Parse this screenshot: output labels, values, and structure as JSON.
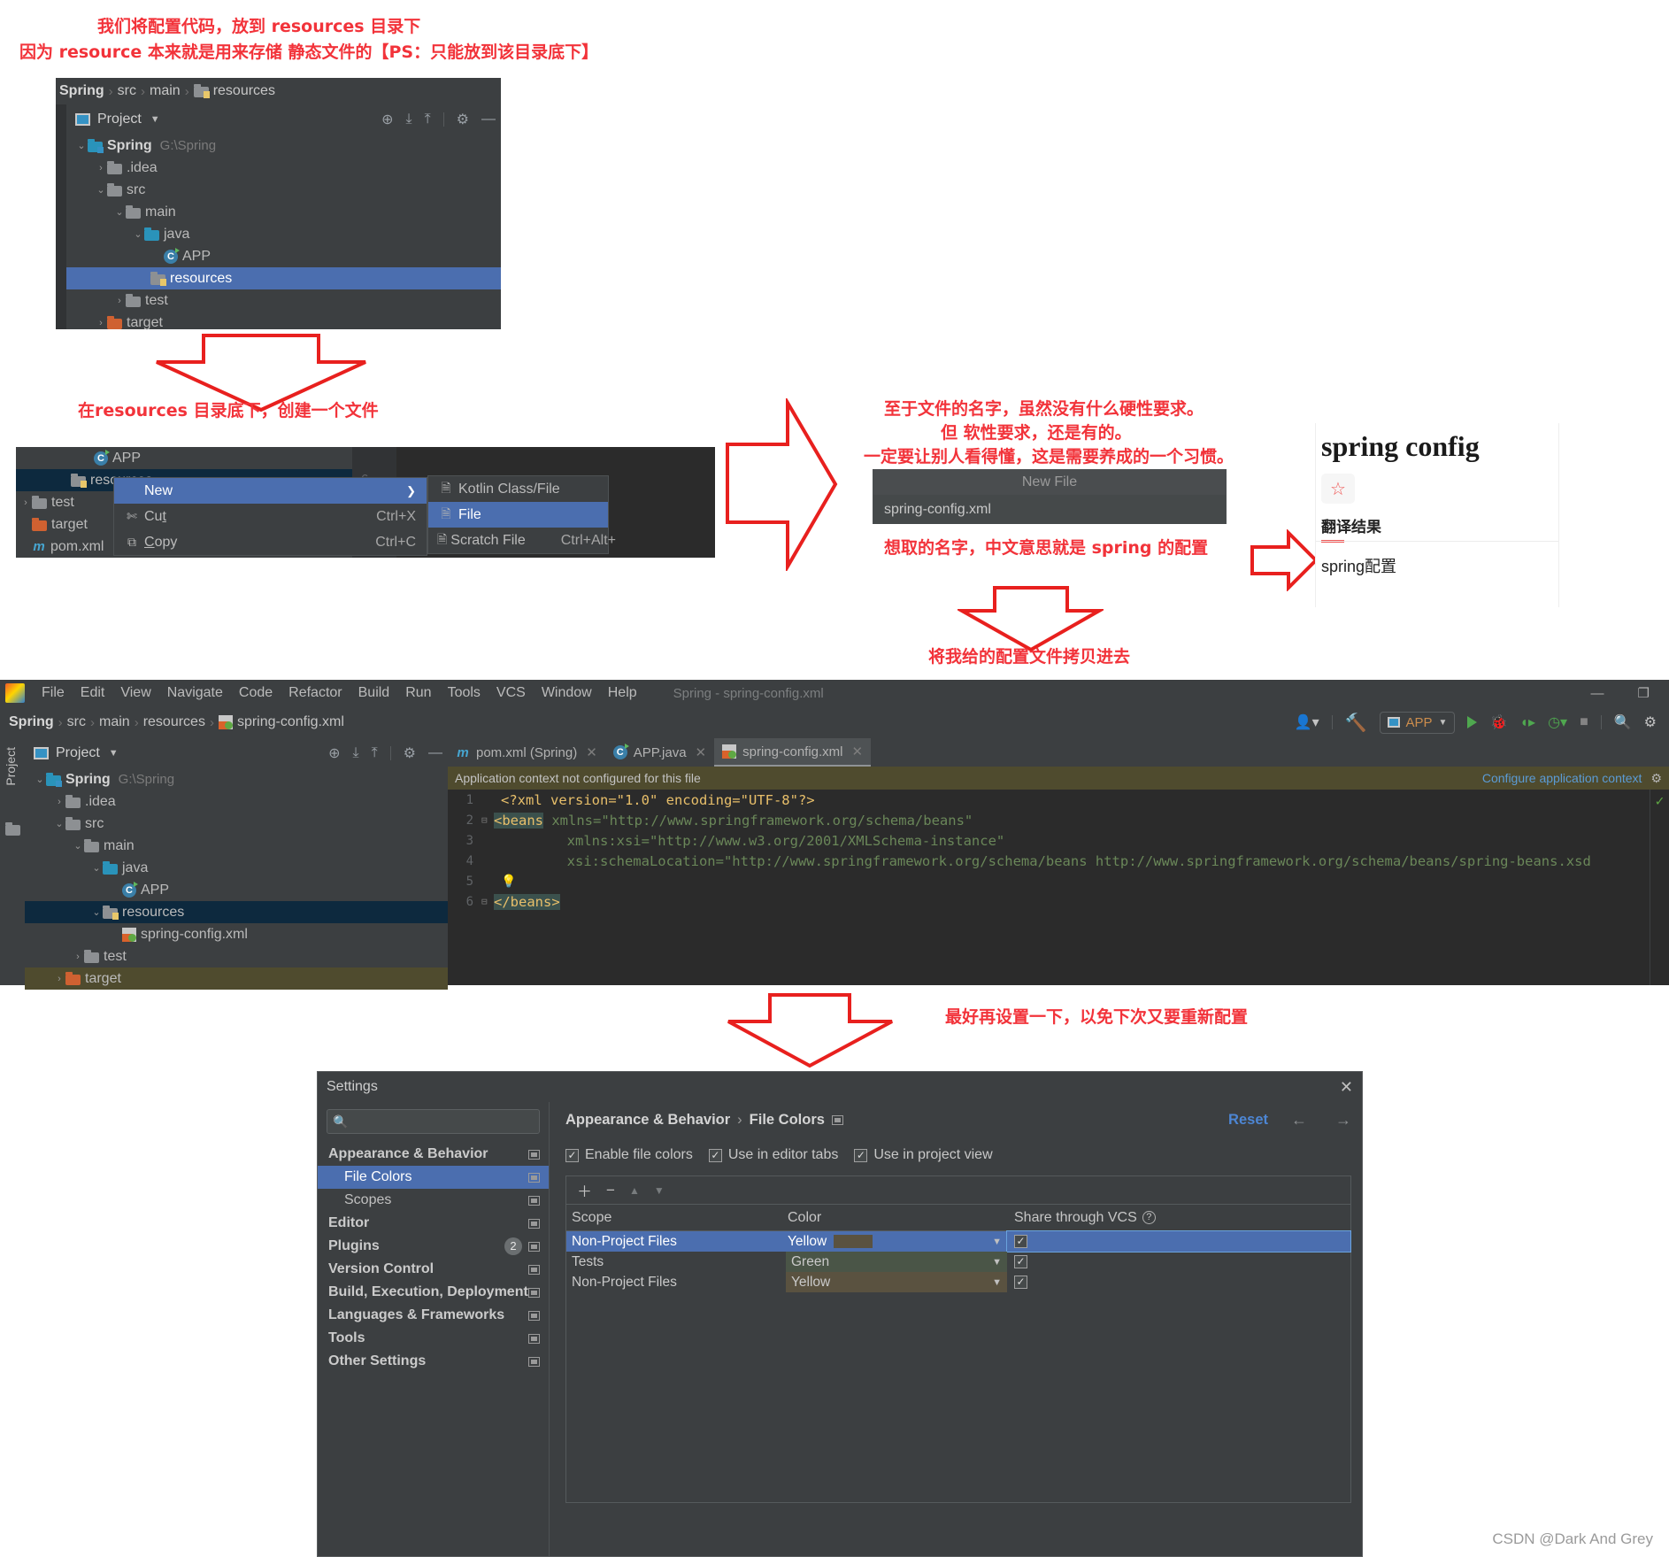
{
  "annotations": {
    "top_line1": "我们将配置代码，放到 resources 目录下",
    "top_line2": "因为 resource 本来就是用来存储 静态文件的【PS：只能放到该目录底下】",
    "create_file": "在resources 目录底下，创建一个文件",
    "name_line1": "至于文件的名字，虽然没有什么硬性要求。",
    "name_line2": "但 软性要求，还是有的。",
    "name_line3": "一定要让别人看得懂，这是需要养成的一个习惯。",
    "name_meaning": "想取的名字，中文意思就是 spring 的配置",
    "copy_config": "将我给的配置文件拷贝进去",
    "settings_hint": "最好再设置一下，以免下次又要重新配置"
  },
  "breadcrumb_top": {
    "items": [
      "Spring",
      "src",
      "main",
      "resources"
    ]
  },
  "project_panel_1": {
    "title": "Project",
    "tree": [
      {
        "label": "Spring",
        "path": "G:\\Spring",
        "icon": "module-folder-icon",
        "arrow": "v",
        "indent": 0,
        "bold": true
      },
      {
        "label": ".idea",
        "path": "",
        "icon": "folder-icon",
        "arrow": ">",
        "indent": 1,
        "bold": false
      },
      {
        "label": "src",
        "path": "",
        "icon": "folder-icon",
        "arrow": "v",
        "indent": 1,
        "bold": false
      },
      {
        "label": "main",
        "path": "",
        "icon": "folder-icon",
        "arrow": "v",
        "indent": 2,
        "bold": false
      },
      {
        "label": "java",
        "path": "",
        "icon": "source-folder-icon",
        "arrow": "v",
        "indent": 3,
        "bold": false
      },
      {
        "label": "APP",
        "path": "",
        "icon": "java-class-icon",
        "arrow": "",
        "indent": 4,
        "bold": false
      },
      {
        "label": "resources",
        "path": "",
        "icon": "resources-folder-icon",
        "arrow": "",
        "indent": 3,
        "bold": false,
        "selected": true
      },
      {
        "label": "test",
        "path": "",
        "icon": "folder-icon",
        "arrow": ">",
        "indent": 2,
        "bold": false
      },
      {
        "label": "target",
        "path": "",
        "icon": "target-folder-icon",
        "arrow": ">",
        "indent": 1,
        "bold": false
      }
    ]
  },
  "context_menu": {
    "tree_rows": [
      {
        "label": "APP",
        "icon": "java-class-icon",
        "indent": 3
      },
      {
        "label": "resources",
        "icon": "resources-folder-icon",
        "indent": 2,
        "selected": true
      },
      {
        "label": "test",
        "icon": "folder-icon",
        "arrow": ">",
        "indent": 1
      },
      {
        "label": "target",
        "icon": "target-folder-icon",
        "indent": 1
      },
      {
        "label": "pom.xml",
        "icon": "maven-icon",
        "indent": 0
      }
    ],
    "items": [
      {
        "label": "New",
        "icon": "",
        "accel": "",
        "submenu": true,
        "selected": true
      },
      {
        "label": "Cut",
        "icon": "scissors-icon",
        "accel": "Ctrl+X",
        "submenu": false
      },
      {
        "label": "Copy",
        "icon": "copy-icon",
        "accel": "Ctrl+C",
        "submenu": false
      }
    ],
    "submenu": [
      {
        "label": "Kotlin Class/File",
        "icon": "kotlin-file-icon",
        "accel": "",
        "selected": false
      },
      {
        "label": "File",
        "icon": "file-icon",
        "accel": "",
        "selected": true
      },
      {
        "label": "Scratch File",
        "icon": "scratch-file-icon",
        "accel": "Ctrl+Alt+",
        "selected": false
      }
    ],
    "gutter_numbers": [
      "6"
    ]
  },
  "new_file_dialog": {
    "title": "New File",
    "value": "spring-config.xml"
  },
  "translate_card": {
    "word": "spring config",
    "star_icon": "star-outline-icon",
    "section": "翻译结果",
    "result": "spring配置"
  },
  "ide": {
    "menus": [
      "File",
      "Edit",
      "View",
      "Navigate",
      "Code",
      "Refactor",
      "Build",
      "Run",
      "Tools",
      "VCS",
      "Window",
      "Help"
    ],
    "window_title": "Spring - spring-config.xml",
    "window_buttons": [
      "minimize",
      "restore"
    ],
    "breadcrumb": [
      "Spring",
      "src",
      "main",
      "resources",
      "spring-config.xml"
    ],
    "toolbar": {
      "run_config": "APP",
      "icons": [
        "user-icon",
        "build-icon",
        "run-icon",
        "debug-icon",
        "run-coverage-icon",
        "profiler-icon",
        "stop-icon",
        "search-icon",
        "settings-icon"
      ]
    },
    "left_strip": "Project",
    "project_panel": {
      "title": "Project",
      "tree": [
        {
          "label": "Spring",
          "path": "G:\\Spring",
          "icon": "module-folder-icon",
          "arrow": "v",
          "indent": 0,
          "bold": true
        },
        {
          "label": ".idea",
          "path": "",
          "icon": "folder-icon",
          "arrow": ">",
          "indent": 1,
          "bold": false
        },
        {
          "label": "src",
          "path": "",
          "icon": "folder-icon",
          "arrow": "v",
          "indent": 1,
          "bold": false
        },
        {
          "label": "main",
          "path": "",
          "icon": "folder-icon",
          "arrow": "v",
          "indent": 2,
          "bold": false
        },
        {
          "label": "java",
          "path": "",
          "icon": "source-folder-icon",
          "arrow": "v",
          "indent": 3,
          "bold": false
        },
        {
          "label": "APP",
          "path": "",
          "icon": "java-class-icon",
          "arrow": "",
          "indent": 4,
          "bold": false
        },
        {
          "label": "resources",
          "path": "",
          "icon": "resources-folder-icon",
          "arrow": "v",
          "indent": 3,
          "bold": false,
          "selected": true
        },
        {
          "label": "spring-config.xml",
          "path": "",
          "icon": "spring-xml-icon",
          "arrow": "",
          "indent": 4,
          "bold": false
        },
        {
          "label": "test",
          "path": "",
          "icon": "folder-icon",
          "arrow": ">",
          "indent": 2,
          "bold": false
        },
        {
          "label": "target",
          "path": "",
          "icon": "target-folder-icon",
          "arrow": ">",
          "indent": 1,
          "bold": false
        }
      ]
    },
    "tabs": [
      {
        "label": "pom.xml (Spring)",
        "icon": "maven-icon",
        "active": false
      },
      {
        "label": "APP.java",
        "icon": "java-class-icon",
        "active": false
      },
      {
        "label": "spring-config.xml",
        "icon": "spring-xml-icon",
        "active": true
      }
    ],
    "notification": {
      "message": "Application context not configured for this file",
      "action": "Configure application context",
      "gear_icon": "gear-icon"
    },
    "code": {
      "lines": [
        "1",
        "2",
        "3",
        "4",
        "5",
        "6"
      ],
      "text": {
        "l1": "<?xml version=\"1.0\" encoding=\"UTF-8\"?>",
        "l2_tag": "<beans",
        "l2_rest": " xmlns=\"http://www.springframework.org/schema/beans\"",
        "l3": "        xmlns:xsi=\"http://www.w3.org/2001/XMLSchema-instance\"",
        "l4": "        xsi:schemaLocation=\"http://www.springframework.org/schema/beans http://www.springframework.org/schema/beans/spring-beans.xsd",
        "l5": "",
        "l6": "</beans>"
      }
    }
  },
  "settings": {
    "title": "Settings",
    "close_icon": "close-icon",
    "search_placeholder": "",
    "tree": [
      {
        "label": "Appearance & Behavior",
        "level": 0,
        "selected": false,
        "badge": ""
      },
      {
        "label": "File Colors",
        "level": 1,
        "selected": true,
        "badge": ""
      },
      {
        "label": "Scopes",
        "level": 1,
        "selected": false,
        "badge": ""
      },
      {
        "label": "Editor",
        "level": 0,
        "selected": false,
        "badge": ""
      },
      {
        "label": "Plugins",
        "level": 0,
        "selected": false,
        "badge": "2"
      },
      {
        "label": "Version Control",
        "level": 0,
        "selected": false,
        "badge": ""
      },
      {
        "label": "Build, Execution, Deployment",
        "level": 0,
        "selected": false,
        "badge": ""
      },
      {
        "label": "Languages & Frameworks",
        "level": 0,
        "selected": false,
        "badge": ""
      },
      {
        "label": "Tools",
        "level": 0,
        "selected": false,
        "badge": ""
      },
      {
        "label": "Other Settings",
        "level": 0,
        "selected": false,
        "badge": ""
      }
    ],
    "crumb": [
      "Appearance & Behavior",
      "File Colors"
    ],
    "reset_label": "Reset",
    "checkboxes": [
      {
        "label": "Enable file colors",
        "checked": true
      },
      {
        "label": "Use in editor tabs",
        "checked": true
      },
      {
        "label": "Use in project view",
        "checked": true
      }
    ],
    "table_tools": [
      "add-icon",
      "remove-icon",
      "move-up-icon",
      "move-down-icon"
    ],
    "columns": [
      "Scope",
      "Color",
      "Share through VCS"
    ],
    "rows": [
      {
        "scope": "Non-Project Files",
        "color": "Yellow",
        "vcs": true,
        "selected": true,
        "swatch": "#5a5240"
      },
      {
        "scope": "Tests",
        "color": "Green",
        "vcs": true,
        "selected": false,
        "swatch": "#4a5547"
      },
      {
        "scope": "Non-Project Files",
        "color": "Yellow",
        "vcs": true,
        "selected": false,
        "swatch": "#5a5240"
      }
    ]
  },
  "watermark": "CSDN @Dark And Grey"
}
